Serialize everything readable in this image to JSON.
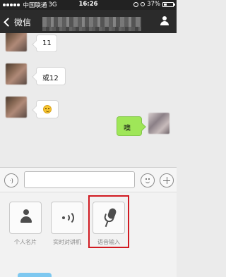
{
  "statusbar": {
    "carrier": "中国联通",
    "network": "3G",
    "time": "16:26",
    "battery": "37%",
    "battery_level": 0.37
  },
  "navbar": {
    "back_label": "微信"
  },
  "messages": [
    {
      "direction": "in",
      "text": "11"
    },
    {
      "direction": "in",
      "text": "或12"
    },
    {
      "direction": "in",
      "emoji": "smile"
    },
    {
      "direction": "out",
      "text": "噢"
    }
  ],
  "tools": [
    {
      "label": "个人名片",
      "icon": "contact-card-icon"
    },
    {
      "label": "实时对讲机",
      "icon": "walkie-talkie-icon"
    },
    {
      "label": "语音输入",
      "icon": "microphone-icon"
    }
  ],
  "colors": {
    "highlight": "#d11a21",
    "outgoing_bubble": "#9fe658",
    "nav_bg": "#2b2b2b"
  }
}
